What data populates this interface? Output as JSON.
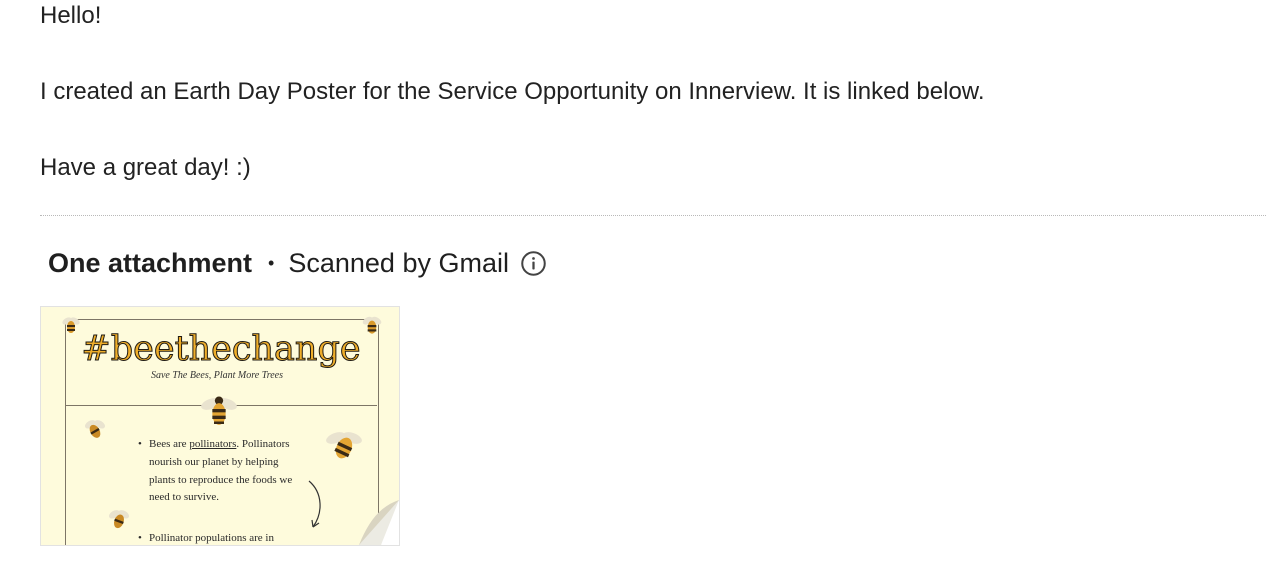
{
  "email": {
    "greeting": "Hello!",
    "body_line": "I created an Earth Day Poster for the Service Opportunity on Innerview. It is linked below.",
    "closing": "Have a great day! :)"
  },
  "attachments": {
    "title": "One attachment",
    "separator": "•",
    "scanned_label": "Scanned by Gmail",
    "info_icon": "info-icon",
    "thumbnail": {
      "heading": "#beethechange",
      "subheading": "Save The Bees, Plant More Trees",
      "bullet_1_prefix": "Bees are ",
      "bullet_1_link": "pollinators",
      "bullet_1_rest": ". Pollinators nourish our planet by helping plants to reproduce the foods we need to survive.",
      "bullet_2": "Pollinator populations are in",
      "bullet_symbol": "•",
      "bee_icon": "bee-icon"
    },
    "colors": {
      "poster_background": "#fefbdc",
      "heading_fill": "#efae2a"
    }
  }
}
